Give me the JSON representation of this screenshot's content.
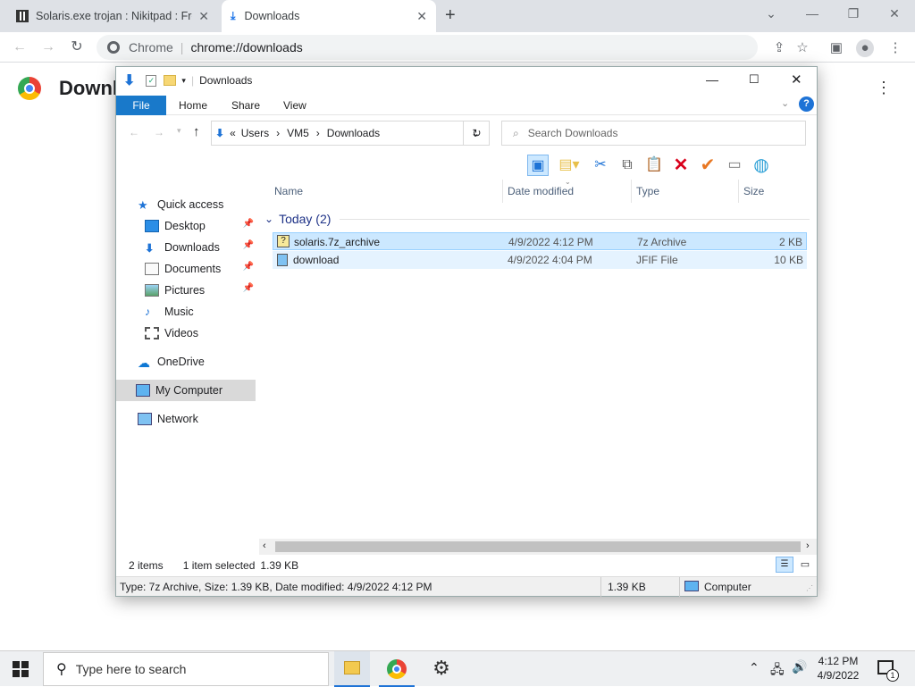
{
  "browser": {
    "tabs": [
      {
        "title": "Solaris.exe trojan : Nikitpad : Free"
      },
      {
        "title": "Downloads"
      }
    ],
    "url_scheme_label": "Chrome",
    "url": "chrome://downloads"
  },
  "page": {
    "heading_partial": "Downl"
  },
  "explorer": {
    "title": "Downloads",
    "ribbon_tabs": [
      "File",
      "Home",
      "Share",
      "View"
    ],
    "breadcrumb": [
      "Users",
      "VM5",
      "Downloads"
    ],
    "breadcrumb_prefix": "«",
    "search_placeholder": "Search Downloads",
    "nav": {
      "quick_access": "Quick access",
      "items": [
        {
          "label": "Desktop",
          "pinned": true
        },
        {
          "label": "Downloads",
          "pinned": true
        },
        {
          "label": "Documents",
          "pinned": true
        },
        {
          "label": "Pictures",
          "pinned": true
        },
        {
          "label": "Music",
          "pinned": false
        },
        {
          "label": "Videos",
          "pinned": false
        }
      ],
      "onedrive": "OneDrive",
      "my_computer": "My Computer",
      "network": "Network"
    },
    "columns": [
      "Name",
      "Date modified",
      "Type",
      "Size"
    ],
    "group_label": "Today (2)",
    "files": [
      {
        "name": "solaris.7z_archive",
        "date": "4/9/2022 4:12 PM",
        "type": "7z Archive",
        "size": "2 KB",
        "selected": true
      },
      {
        "name": "download",
        "date": "4/9/2022 4:04 PM",
        "type": "JFIF File",
        "size": "10 KB",
        "selected": false
      }
    ],
    "status": {
      "items": "2 items",
      "selected": "1 item selected",
      "selected_size": "1.39 KB"
    },
    "details": {
      "text": "Type: 7z Archive, Size: 1.39 KB, Date modified: 4/9/2022 4:12 PM",
      "size": "1.39 KB",
      "location": "Computer"
    }
  },
  "taskbar": {
    "search_placeholder": "Type here to search",
    "time": "4:12 PM",
    "date": "4/9/2022",
    "notification_count": "1"
  }
}
